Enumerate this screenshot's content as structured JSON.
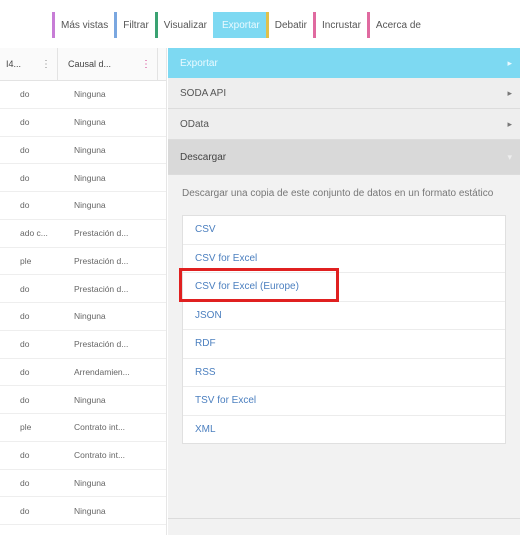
{
  "tabs": [
    {
      "label": "Más vistas",
      "color": "#c77dd6",
      "active": false
    },
    {
      "label": "Filtrar",
      "color": "#7aa7e0",
      "active": false
    },
    {
      "label": "Visualizar",
      "color": "#3aa272",
      "active": false
    },
    {
      "label": "Exportar",
      "color": "#7dd9f2",
      "active": true
    },
    {
      "label": "Debatir",
      "color": "#e0c04a",
      "active": false
    },
    {
      "label": "Incrustar",
      "color": "#e06aa0",
      "active": false
    },
    {
      "label": "Acerca de",
      "color": "#e06aa0",
      "active": false
    }
  ],
  "table": {
    "headers": [
      "I4...",
      "Causal d..."
    ],
    "rows": [
      [
        "do",
        "Ninguna"
      ],
      [
        "do",
        "Ninguna"
      ],
      [
        "do",
        "Ninguna"
      ],
      [
        "do",
        "Ninguna"
      ],
      [
        "do",
        "Ninguna"
      ],
      [
        "ado c...",
        "Prestación d..."
      ],
      [
        "ple",
        "Prestación d..."
      ],
      [
        "do",
        "Prestación d..."
      ],
      [
        "do",
        "Ninguna"
      ],
      [
        "do",
        "Prestación d..."
      ],
      [
        "do",
        "Arrendamien..."
      ],
      [
        "do",
        "Ninguna"
      ],
      [
        "ple",
        "Contrato int..."
      ],
      [
        "do",
        "Contrato int..."
      ],
      [
        "do",
        "Ninguna"
      ],
      [
        "do",
        "Ninguna"
      ]
    ]
  },
  "panel": {
    "header": "Exportar",
    "sections": [
      {
        "label": "SODA API"
      },
      {
        "label": "OData"
      }
    ],
    "download": {
      "label": "Descargar",
      "description": "Descargar una copia de este conjunto de datos en un formato estático",
      "formats": [
        "CSV",
        "CSV for Excel",
        "CSV for Excel (Europe)",
        "JSON",
        "RDF",
        "RSS",
        "TSV for Excel",
        "XML"
      ],
      "highlighted": "CSV for Excel"
    }
  },
  "colors": {
    "accent": "#7dd9f2",
    "link": "#4b7fbf",
    "highlight": "#e02020"
  }
}
